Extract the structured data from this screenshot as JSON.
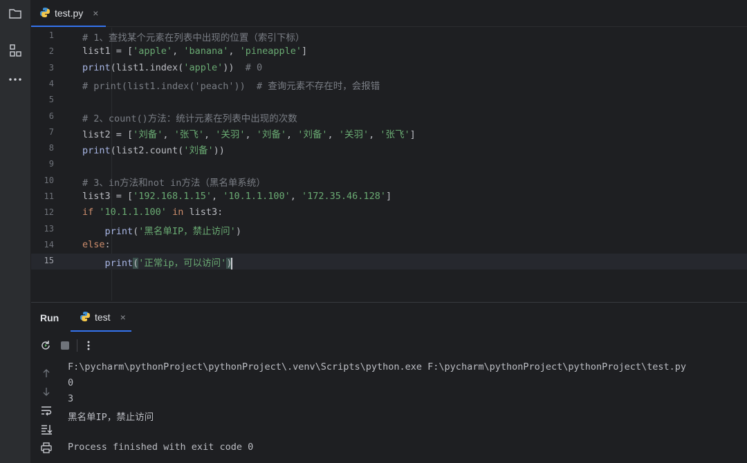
{
  "editor": {
    "tab": {
      "label": "test.py",
      "close": "×"
    },
    "lines": [
      {
        "n": "1",
        "segs": [
          {
            "t": "# 1、查找某个元素在列表中出现的位置（索引下标）",
            "c": "cmt"
          }
        ]
      },
      {
        "n": "2",
        "segs": [
          {
            "t": "list1 = [",
            "c": ""
          },
          {
            "t": "'apple'",
            "c": "str"
          },
          {
            "t": ", ",
            "c": ""
          },
          {
            "t": "'banana'",
            "c": "str"
          },
          {
            "t": ", ",
            "c": ""
          },
          {
            "t": "'pineapple'",
            "c": "str"
          },
          {
            "t": "]",
            "c": ""
          }
        ]
      },
      {
        "n": "3",
        "segs": [
          {
            "t": "print",
            "c": "fn"
          },
          {
            "t": "(list1.index(",
            "c": ""
          },
          {
            "t": "'apple'",
            "c": "str"
          },
          {
            "t": "))  ",
            "c": ""
          },
          {
            "t": "# 0",
            "c": "cmt"
          }
        ]
      },
      {
        "n": "4",
        "segs": [
          {
            "t": "# print(list1.index('peach'))  # 查询元素不存在时，会报错",
            "c": "cmt"
          }
        ]
      },
      {
        "n": "5",
        "segs": []
      },
      {
        "n": "6",
        "segs": [
          {
            "t": "# 2、count()方法：统计元素在列表中出现的次数",
            "c": "cmt"
          }
        ]
      },
      {
        "n": "7",
        "segs": [
          {
            "t": "list2 = [",
            "c": ""
          },
          {
            "t": "'刘备'",
            "c": "str"
          },
          {
            "t": ", ",
            "c": ""
          },
          {
            "t": "'张飞'",
            "c": "str"
          },
          {
            "t": ", ",
            "c": ""
          },
          {
            "t": "'关羽'",
            "c": "str"
          },
          {
            "t": ", ",
            "c": ""
          },
          {
            "t": "'刘备'",
            "c": "str"
          },
          {
            "t": ", ",
            "c": ""
          },
          {
            "t": "'刘备'",
            "c": "str"
          },
          {
            "t": ", ",
            "c": ""
          },
          {
            "t": "'关羽'",
            "c": "str"
          },
          {
            "t": ", ",
            "c": ""
          },
          {
            "t": "'张飞'",
            "c": "str"
          },
          {
            "t": "]",
            "c": ""
          }
        ]
      },
      {
        "n": "8",
        "segs": [
          {
            "t": "print",
            "c": "fn"
          },
          {
            "t": "(list2.count(",
            "c": ""
          },
          {
            "t": "'刘备'",
            "c": "str"
          },
          {
            "t": "))",
            "c": ""
          }
        ]
      },
      {
        "n": "9",
        "segs": []
      },
      {
        "n": "10",
        "segs": [
          {
            "t": "# 3、in方法和not in方法（黑名单系统）",
            "c": "cmt"
          }
        ]
      },
      {
        "n": "11",
        "segs": [
          {
            "t": "list3 = [",
            "c": ""
          },
          {
            "t": "'192.168.1.15'",
            "c": "str"
          },
          {
            "t": ", ",
            "c": ""
          },
          {
            "t": "'10.1.1.100'",
            "c": "str"
          },
          {
            "t": ", ",
            "c": ""
          },
          {
            "t": "'172.35.46.128'",
            "c": "str"
          },
          {
            "t": "]",
            "c": ""
          }
        ]
      },
      {
        "n": "12",
        "segs": [
          {
            "t": "if ",
            "c": "kw"
          },
          {
            "t": "'10.1.1.100'",
            "c": "str"
          },
          {
            "t": " in ",
            "c": "kw"
          },
          {
            "t": "list3:",
            "c": ""
          }
        ]
      },
      {
        "n": "13",
        "segs": [
          {
            "t": "    ",
            "c": ""
          },
          {
            "t": "print",
            "c": "fn"
          },
          {
            "t": "(",
            "c": ""
          },
          {
            "t": "'黑名单IP，禁止访问'",
            "c": "str"
          },
          {
            "t": ")",
            "c": ""
          }
        ]
      },
      {
        "n": "14",
        "segs": [
          {
            "t": "else",
            "c": "kw"
          },
          {
            "t": ":",
            "c": ""
          }
        ]
      },
      {
        "n": "15",
        "segs": [
          {
            "t": "    ",
            "c": ""
          },
          {
            "t": "print",
            "c": "fn"
          },
          {
            "t": "(",
            "c": "br-hl"
          },
          {
            "t": "'正常ip，可以访问'",
            "c": "str"
          },
          {
            "t": ")",
            "c": "br-hl"
          }
        ],
        "current": true
      }
    ]
  },
  "run": {
    "title": "Run",
    "tab_label": "test",
    "tab_close": "×",
    "output": [
      "F:\\pycharm\\pythonProject\\pythonProject\\.venv\\Scripts\\python.exe F:\\pycharm\\pythonProject\\pythonProject\\test.py",
      "0",
      "3",
      "黑名单IP，禁止访问",
      "",
      "Process finished with exit code 0"
    ]
  },
  "icons": {
    "sidebar": [
      "folder-icon",
      "structure-icon",
      "more-icon"
    ],
    "run_toolbar": [
      "rerun-icon",
      "stop-icon",
      "more-vertical-icon"
    ],
    "run_left": [
      "up-arrow-icon",
      "down-arrow-icon",
      "soft-wrap-icon",
      "scroll-to-end-icon",
      "print-icon"
    ]
  },
  "colors": {
    "accent": "#3574f0",
    "string": "#6aab73",
    "keyword": "#cf8e6d",
    "comment": "#7a7e85",
    "function": "#a9b7e6"
  }
}
